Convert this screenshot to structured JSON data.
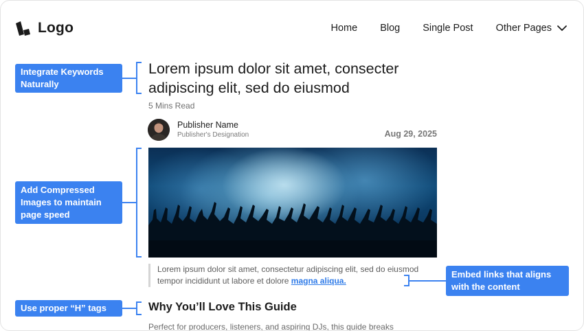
{
  "header": {
    "logo_text": "Logo",
    "nav": [
      "Home",
      "Blog",
      "Single Post"
    ],
    "dropdown_label": "Other Pages"
  },
  "article": {
    "title": "Lorem ipsum dolor sit amet, consecter adipiscing elit, sed do eiusmod",
    "read_time": "5 Mins Read",
    "publisher_name": "Publisher Name",
    "publisher_designation": "Publisher's Designation",
    "date": "Aug 29, 2025",
    "quote_text": "Lorem ipsum dolor sit amet, consectetur adipiscing elit, sed do eiusmod tempor incididunt ut labore et dolore ",
    "quote_link": "magna aliqua.",
    "subheading": "Why You’ll Love This Guide",
    "paragraph": "Perfect for producers, listeners, and aspiring DJs, this guide breaks"
  },
  "annotations": {
    "keywords": "Integrate Keywords Naturally",
    "images": "Add Compressed Images to maintain page speed",
    "links": "Embed links that aligns with the content",
    "tags": "Use proper “H” tags"
  },
  "colors": {
    "accent": "#3b82f0",
    "link": "#2f7be8"
  }
}
